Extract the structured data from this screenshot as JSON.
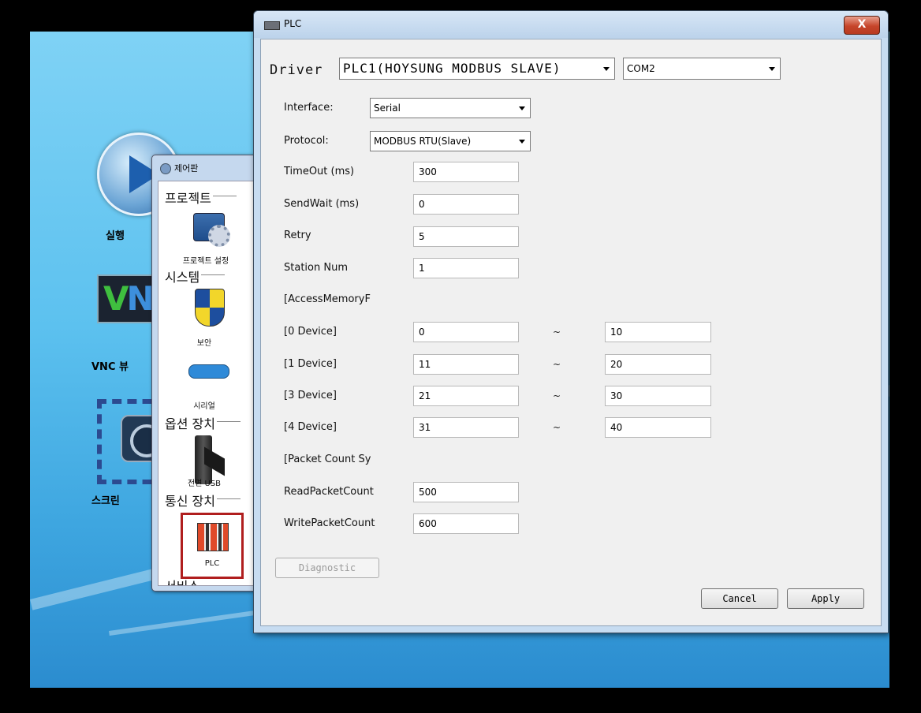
{
  "desktop": {
    "icons": [
      {
        "label": "실행",
        "icon": "play-icon"
      },
      {
        "label": "VNC 뷰",
        "icon": "vnc-icon"
      },
      {
        "label": "스크린",
        "icon": "screen-icon"
      }
    ],
    "vnc_text": {
      "v": "V",
      "n": "N"
    }
  },
  "control_panel": {
    "title": "제어판",
    "sections": [
      {
        "label": "프로젝트",
        "items": [
          {
            "label": "프로젝트 설정",
            "icon": "project-settings-icon"
          }
        ]
      },
      {
        "label": "시스템",
        "items": [
          {
            "label": "보안",
            "icon": "shield-icon"
          },
          {
            "label": "시리얼",
            "icon": "serial-port-icon"
          }
        ]
      },
      {
        "label": "옵션 장치",
        "items": [
          {
            "label": "전면 USB",
            "icon": "usb-icon"
          }
        ]
      },
      {
        "label": "통신 장치",
        "items": [
          {
            "label": "PLC",
            "icon": "plc-icon"
          }
        ]
      },
      {
        "label": "서비스",
        "items": []
      }
    ],
    "highlight_color": "#b01e1e"
  },
  "plc_dialog": {
    "title": "PLC",
    "close_label": "X",
    "driver_label": "Driver",
    "driver_value": "PLC1(HOYSUNG MODBUS SLAVE)",
    "port_value": "COM2",
    "interface_label": "Interface:",
    "interface_value": "Serial",
    "protocol_label": "Protocol:",
    "protocol_value": "MODBUS RTU(Slave)",
    "fields": [
      {
        "label": "TimeOut (ms)",
        "value": "300"
      },
      {
        "label": "SendWait (ms)",
        "value": "0"
      },
      {
        "label": "Retry",
        "value": "5"
      },
      {
        "label": "Station Num",
        "value": "1"
      }
    ],
    "access_header": "[AccessMemoryF",
    "devices": [
      {
        "label": "[0 Device]",
        "from": "0",
        "to": "10"
      },
      {
        "label": "[1 Device]",
        "from": "11",
        "to": "20"
      },
      {
        "label": "[3 Device]",
        "from": "21",
        "to": "30"
      },
      {
        "label": "[4 Device]",
        "from": "31",
        "to": "40"
      }
    ],
    "range_separator": "~",
    "packet_header": "[Packet Count Sy",
    "packet_fields": [
      {
        "label": "ReadPacketCount",
        "value": "500"
      },
      {
        "label": "WritePacketCount",
        "value": "600"
      }
    ],
    "diagnostic_label": "Diagnostic",
    "cancel_label": "Cancel",
    "apply_label": "Apply"
  }
}
